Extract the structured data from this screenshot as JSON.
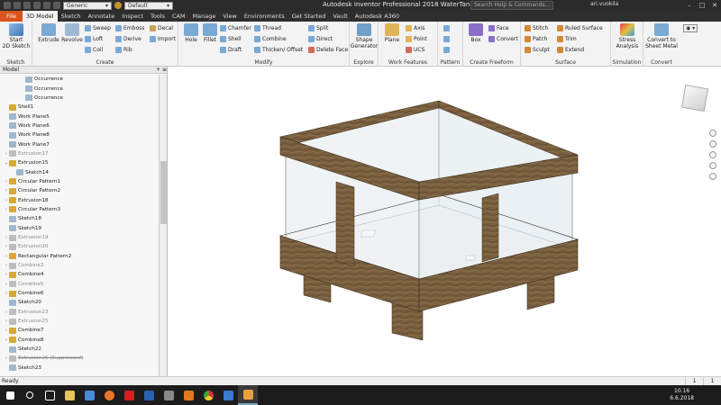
{
  "app": {
    "title": "Autodesk Inventor Professional 2018   WaterTank",
    "search_placeholder": "Search Help & Commands...",
    "user": "ari.vuokila",
    "material_select": "Generic",
    "appearance_select": "Default"
  },
  "tabs": [
    "File",
    "3D Model",
    "Sketch",
    "Annotate",
    "Inspect",
    "Tools",
    "CAM",
    "Manage",
    "View",
    "Environments",
    "Get Started",
    "Vault",
    "Autodesk A360"
  ],
  "active_tab": "3D Model",
  "ribbon": {
    "sketch": {
      "title": "Sketch",
      "start_label": "Start\n2D Sketch"
    },
    "create": {
      "title": "Create",
      "extrude": "Extrude",
      "revolve": "Revolve",
      "sweep": "Sweep",
      "loft": "Loft",
      "coil": "Coil",
      "emboss": "Emboss",
      "derive": "Derive",
      "rib": "Rib",
      "decal": "Decal",
      "import": "Import"
    },
    "modify": {
      "title": "Modify",
      "hole": "Hole",
      "fillet": "Fillet",
      "chamfer": "Chamfer",
      "shell": "Shell",
      "draft": "Draft",
      "thread": "Thread",
      "combine": "Combine",
      "thicken": "Thicken/ Offset",
      "split": "Split",
      "direct": "Direct",
      "delete_face": "Delete Face"
    },
    "explore": {
      "title": "Explore",
      "shape_generator": "Shape\nGenerator"
    },
    "work_features": {
      "title": "Work Features",
      "plane": "Plane",
      "axis": "Axis",
      "point": "Point",
      "ucs": "UCS"
    },
    "pattern": {
      "title": "Pattern"
    },
    "freeform": {
      "title": "Create Freeform",
      "box": "Box",
      "face": "Face",
      "convert": "Convert"
    },
    "surface": {
      "title": "Surface",
      "stitch": "Stitch",
      "patch": "Patch",
      "sculpt": "Sculpt",
      "ruled_surface": "Ruled Surface",
      "trim": "Trim",
      "extend": "Extend"
    },
    "simulation": {
      "title": "Simulation",
      "stress": "Stress\nAnalysis"
    },
    "convert": {
      "title": "Convert",
      "sheet_metal": "Convert to\nSheet Metal"
    }
  },
  "browser": {
    "title": "Model",
    "items": [
      {
        "label": "Occurrence",
        "style": "normal",
        "exp": ""
      },
      {
        "label": "Occurrence",
        "style": "normal",
        "exp": ""
      },
      {
        "label": "Occurrence",
        "style": "normal",
        "exp": ""
      },
      {
        "label": "Shell1",
        "style": "normal",
        "exp": ""
      },
      {
        "label": "Work Plane5",
        "style": "normal",
        "exp": ""
      },
      {
        "label": "Work Plane6",
        "style": "normal",
        "exp": ""
      },
      {
        "label": "Work Plane8",
        "style": "normal",
        "exp": ""
      },
      {
        "label": "Work Plane7",
        "style": "normal",
        "exp": ""
      },
      {
        "label": "Extrusion17",
        "style": "dim",
        "exp": "›"
      },
      {
        "label": "Extrusion15",
        "style": "normal",
        "exp": "⌄"
      },
      {
        "label": "Sketch14",
        "style": "normal",
        "exp": ""
      },
      {
        "label": "Circular Pattern1",
        "style": "normal",
        "exp": "›"
      },
      {
        "label": "Circular Pattern2",
        "style": "normal",
        "exp": "›"
      },
      {
        "label": "Extrusion18",
        "style": "normal",
        "exp": "›"
      },
      {
        "label": "Circular Pattern3",
        "style": "normal",
        "exp": "›"
      },
      {
        "label": "Sketch18",
        "style": "normal",
        "exp": ""
      },
      {
        "label": "Sketch19",
        "style": "normal",
        "exp": ""
      },
      {
        "label": "Extrusion19",
        "style": "dim",
        "exp": "›"
      },
      {
        "label": "Extrusion20",
        "style": "dim",
        "exp": "›"
      },
      {
        "label": "Rectangular Pattern2",
        "style": "normal",
        "exp": "›"
      },
      {
        "label": "Combine3",
        "style": "dim",
        "exp": "›"
      },
      {
        "label": "Combine4",
        "style": "normal",
        "exp": "›"
      },
      {
        "label": "Combine5",
        "style": "dim",
        "exp": "›"
      },
      {
        "label": "Combine6",
        "style": "normal",
        "exp": "›"
      },
      {
        "label": "Sketch20",
        "style": "normal",
        "exp": ""
      },
      {
        "label": "Extrusion23",
        "style": "dim",
        "exp": "›"
      },
      {
        "label": "Extrusion25",
        "style": "dim",
        "exp": "›"
      },
      {
        "label": "Combine7",
        "style": "normal",
        "exp": "›"
      },
      {
        "label": "Combine8",
        "style": "normal",
        "exp": "›"
      },
      {
        "label": "Sketch22",
        "style": "normal",
        "exp": ""
      },
      {
        "label": "Extrusion26 (Suppressed)",
        "style": "strike",
        "exp": "›"
      },
      {
        "label": "Sketch23",
        "style": "normal",
        "exp": ""
      }
    ]
  },
  "status": {
    "text": "Ready",
    "page_a": "1",
    "page_b": "1"
  },
  "taskbar": {
    "time": "10.16",
    "date": "6.6.2018"
  },
  "colors": {
    "file_tab": "#d9541e",
    "wood": "#7a6040",
    "glass": "#e8eef2"
  }
}
